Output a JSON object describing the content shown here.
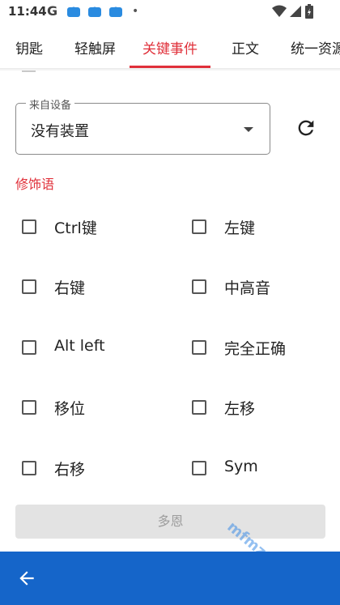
{
  "status_bar": {
    "time": "11:44",
    "g": "G",
    "dot": "•"
  },
  "tabs": [
    {
      "label": "钥匙"
    },
    {
      "label": "轻触屏"
    },
    {
      "label": "关键事件"
    },
    {
      "label": "正文"
    },
    {
      "label": "统一资源"
    }
  ],
  "active_tab_index": 2,
  "device": {
    "legend": "来自设备",
    "value": "没有装置"
  },
  "modifiers": {
    "title": "修饰语",
    "items": [
      {
        "label": "Ctrl键",
        "checked": false
      },
      {
        "label": "左键",
        "checked": false
      },
      {
        "label": "右键",
        "checked": false
      },
      {
        "label": "中高音",
        "checked": false
      },
      {
        "label": "Alt left",
        "checked": false
      },
      {
        "label": "完全正确",
        "checked": false
      },
      {
        "label": "移位",
        "checked": false
      },
      {
        "label": "左移",
        "checked": false
      },
      {
        "label": "右移",
        "checked": false
      },
      {
        "label": "Sym",
        "checked": false
      }
    ]
  },
  "done_button": {
    "label": "多恩"
  },
  "watermark": {
    "text": "mfmz.com"
  },
  "colors": {
    "accent": "#e0303a",
    "bottom_bar": "#1565c9"
  }
}
